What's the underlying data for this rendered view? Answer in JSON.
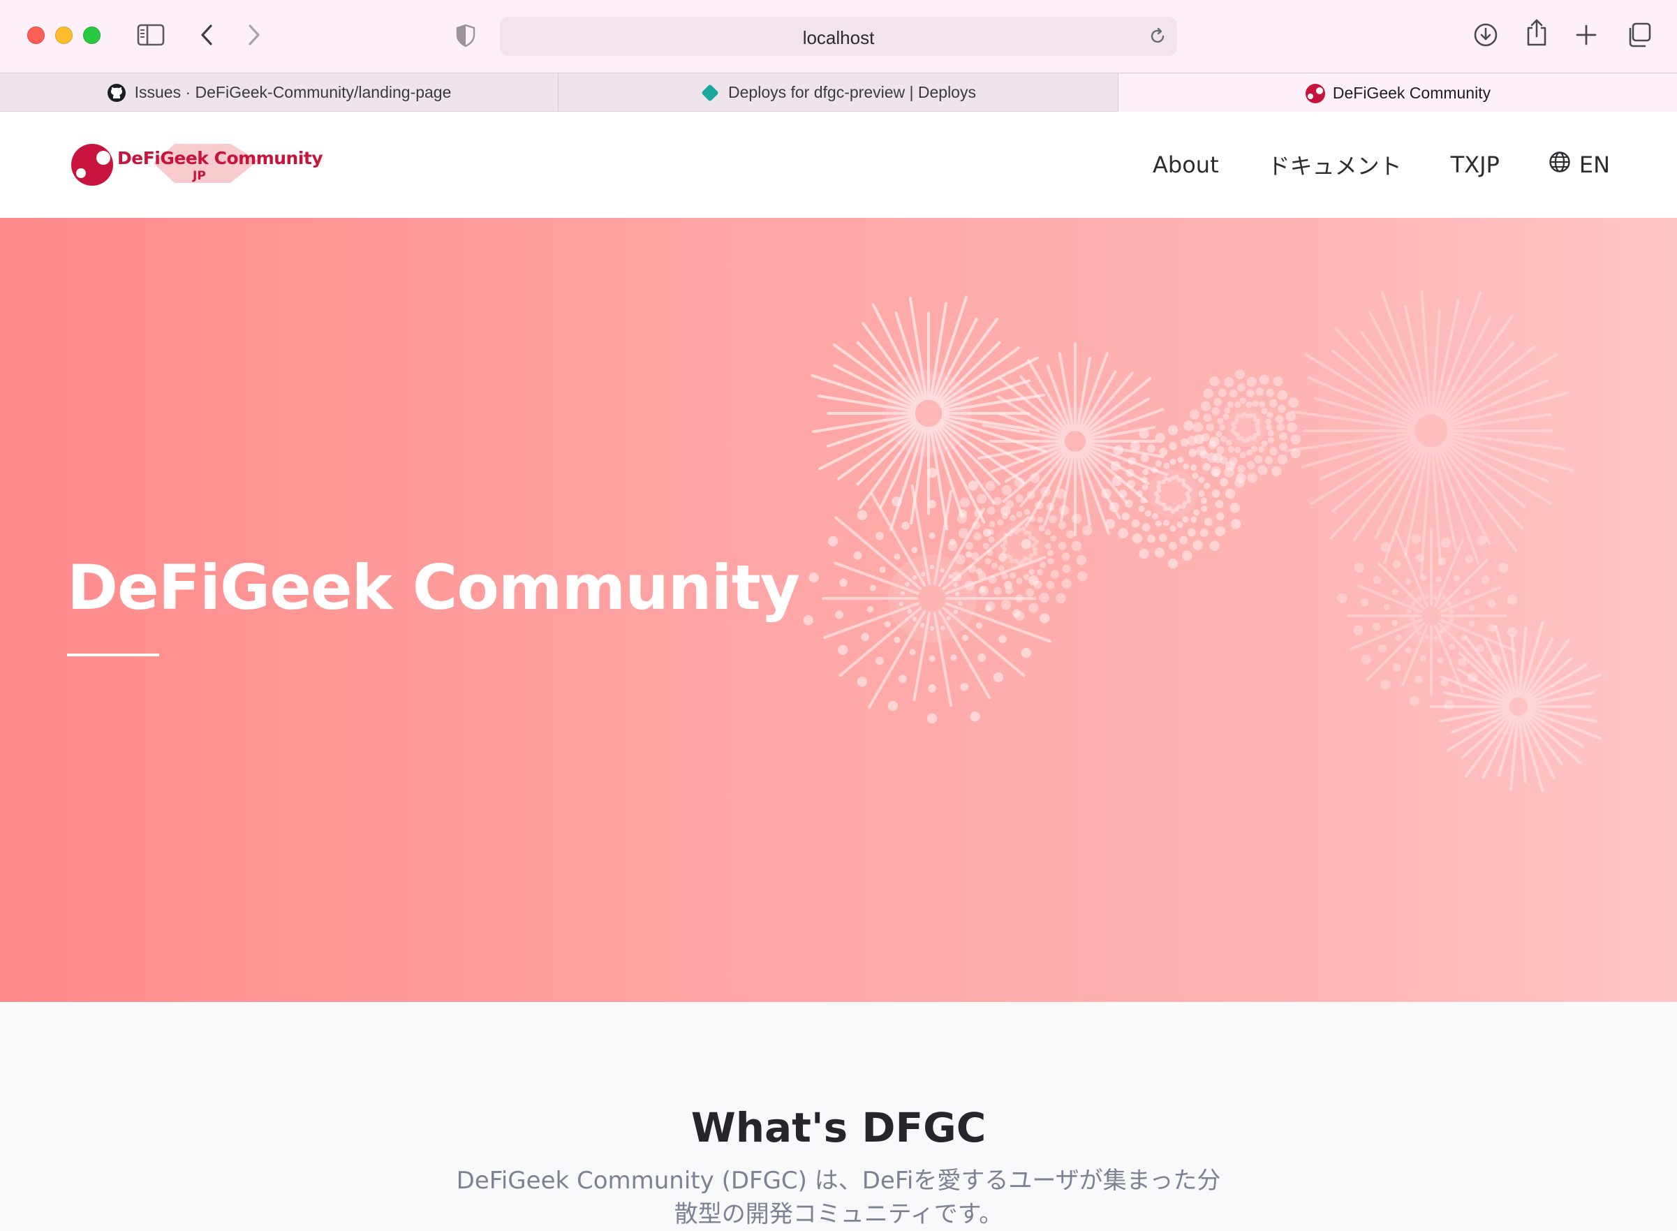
{
  "browser": {
    "url": "localhost",
    "tabs": [
      {
        "title": "Issues · DeFiGeek-Community/landing-page",
        "icon": "github-icon"
      },
      {
        "title": "Deploys for dfgc-preview | Deploys",
        "icon": "netlify-icon"
      },
      {
        "title": "DeFiGeek Community",
        "icon": "dfgc-favicon-icon",
        "active": true
      }
    ]
  },
  "header": {
    "logo_text": "DeFiGeek Community",
    "logo_sub": "JP",
    "nav": {
      "about": "About",
      "docs": "ドキュメント",
      "txjp": "TXJP",
      "language": "EN"
    }
  },
  "hero": {
    "title": "DeFiGeek Community"
  },
  "about_section": {
    "title": "What's DFGC",
    "body": "DeFiGeek Community (DFGC) は、DeFiを愛するユーザが集まった分散型の開発コミュニティです。"
  },
  "colors": {
    "brand": "#c8143c",
    "hero_start": "#ff8a8a",
    "hero_end": "#ffc6c6"
  }
}
